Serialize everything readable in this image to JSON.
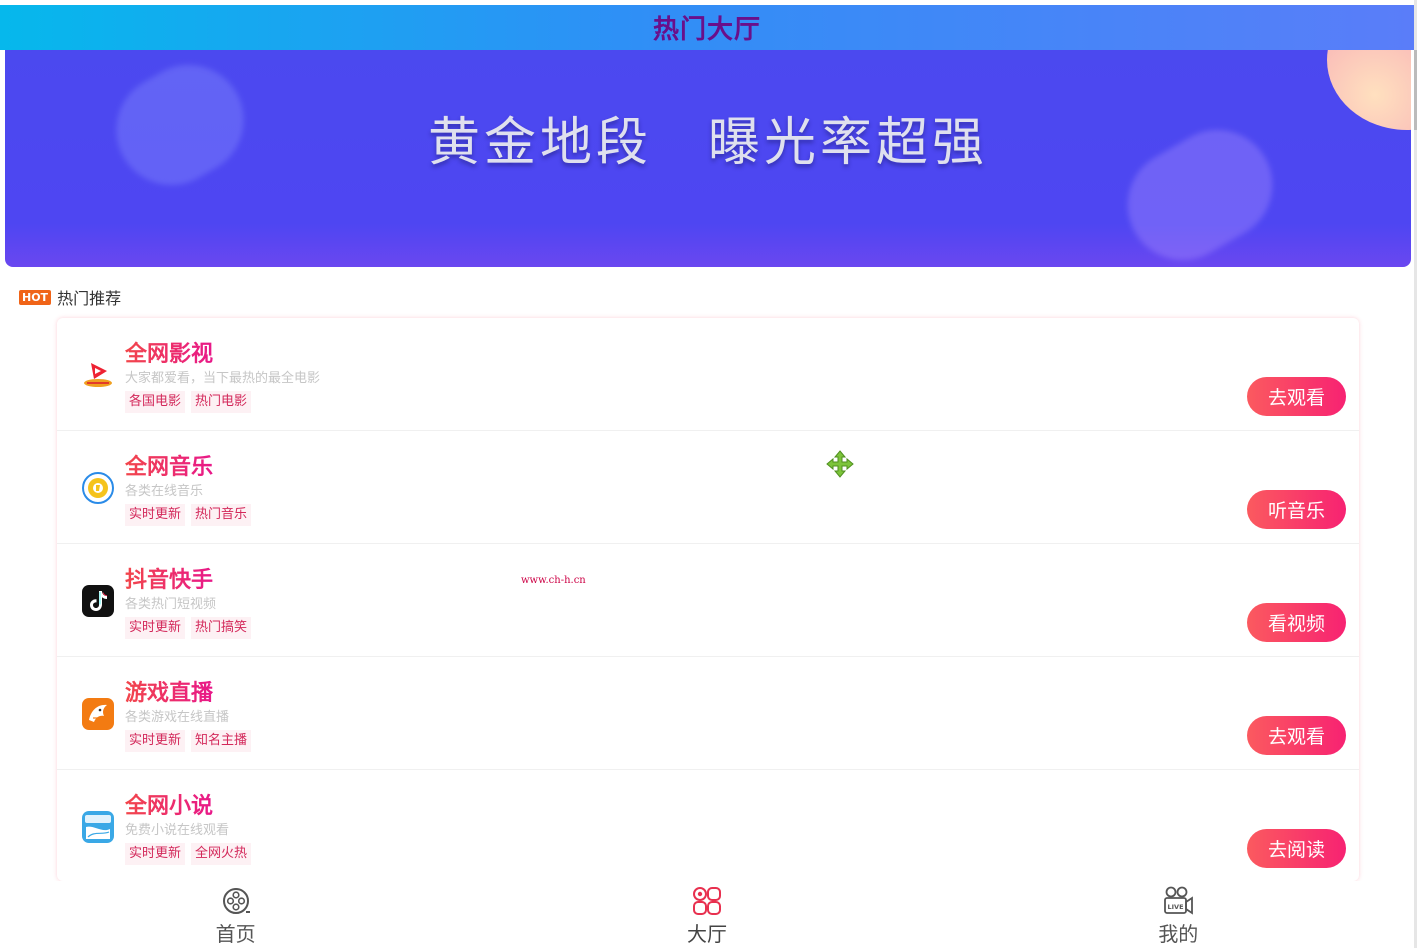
{
  "header": {
    "title": "热门大厅"
  },
  "banner": {
    "text": "黄金地段　曝光率超强"
  },
  "section": {
    "badge": "HOT",
    "title": "热门推荐"
  },
  "items": [
    {
      "title": "全网影视",
      "desc": "大家都爱看，当下最热的最全电影",
      "tags": [
        "各国电影",
        "热门电影"
      ],
      "button": "去观看",
      "icon": "video-play-icon"
    },
    {
      "title": "全网音乐",
      "desc": "各类在线音乐",
      "tags": [
        "实时更新",
        "热门音乐"
      ],
      "button": "听音乐",
      "icon": "music-disc-icon"
    },
    {
      "title": "抖音快手",
      "desc": "各类热门短视频",
      "tags": [
        "实时更新",
        "热门搞笑"
      ],
      "button": "看视频",
      "icon": "tiktok-icon"
    },
    {
      "title": "游戏直播",
      "desc": "各类游戏在线直播",
      "tags": [
        "实时更新",
        "知名主播"
      ],
      "button": "去观看",
      "icon": "shark-icon"
    },
    {
      "title": "全网小说",
      "desc": "免费小说在线观看",
      "tags": [
        "实时更新",
        "全网火热"
      ],
      "button": "去阅读",
      "icon": "novel-book-icon"
    }
  ],
  "watermark": "www.ch-h.cn",
  "tabbar": [
    {
      "label": "首页",
      "icon": "film-reel-icon",
      "active": false
    },
    {
      "label": "大厅",
      "icon": "grid-icon",
      "active": true
    },
    {
      "label": "我的",
      "icon": "live-camera-icon",
      "active": false
    }
  ],
  "colors": {
    "accent": "#f72272",
    "header_title": "#6a0f8a",
    "banner": "#4b49ef",
    "hot_badge": "#f06418"
  }
}
